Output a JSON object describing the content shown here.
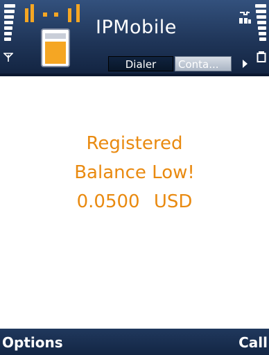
{
  "header": {
    "app_title": "IPMobile",
    "tabs": [
      {
        "label": "Dialer",
        "selected": true
      },
      {
        "label": "Conta...",
        "selected": false
      }
    ]
  },
  "status": {
    "message_lines": [
      "Registered",
      "Balance Low!"
    ],
    "balance_amount": "0.0500",
    "balance_currency": "USD"
  },
  "softkeys": {
    "left_label": "Options",
    "right_label": "Call"
  },
  "colors": {
    "header_bg": "#1f3558",
    "message_text": "#e98a10",
    "softkey_bg": "#1a3051",
    "icon_orange": "#f5a623"
  },
  "icons": {
    "signal": "signal-strength-icon",
    "battery": "battery-level-icon",
    "network": "network-status-icon",
    "app": "ipmobile-app-icon"
  }
}
